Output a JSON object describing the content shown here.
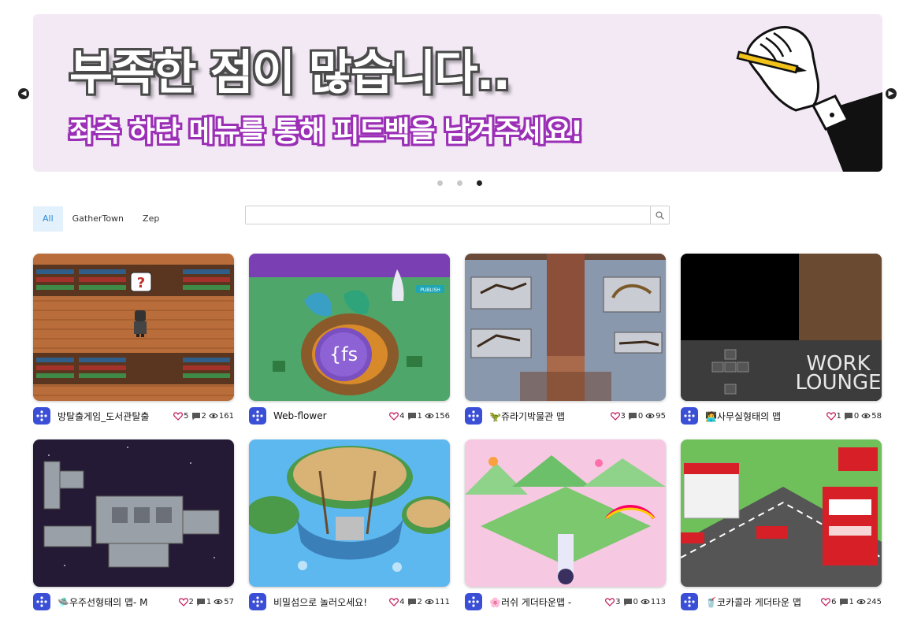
{
  "banner": {
    "title": "부족한 점이 많습니다..",
    "subtitle": "좌측 하단 메뉴를 통해 피드백을 남겨주세요!",
    "accent": "#9b2fb6",
    "background": "#f3e9f5",
    "dots": 3,
    "active_dot": 3
  },
  "filters": {
    "tabs": [
      {
        "label": "All",
        "active": true
      },
      {
        "label": "GatherTown",
        "active": false
      },
      {
        "label": "Zep",
        "active": false
      }
    ]
  },
  "search": {
    "placeholder": "",
    "value": ""
  },
  "cards": [
    {
      "title": "방탈출게임_도서관탈출",
      "likes": "5",
      "comments": "2",
      "views": "161",
      "thumb": "library"
    },
    {
      "title": "Web-flower",
      "likes": "4",
      "comments": "1",
      "views": "156",
      "thumb": "webflower"
    },
    {
      "title": "🦖쥬라기박물관 맵",
      "likes": "3",
      "comments": "0",
      "views": "95",
      "thumb": "museum"
    },
    {
      "title": "🧑‍💻사무실형태의 맵",
      "likes": "1",
      "comments": "0",
      "views": "58",
      "thumb": "lounge"
    },
    {
      "title": "🛸우주선형태의 맵- M",
      "likes": "2",
      "comments": "1",
      "views": "57",
      "thumb": "spaceship"
    },
    {
      "title": "비밀섬으로 놀러오세요!",
      "likes": "4",
      "comments": "2",
      "views": "111",
      "thumb": "island"
    },
    {
      "title": "🌸러쉬 게더타운맵 -",
      "likes": "3",
      "comments": "0",
      "views": "113",
      "thumb": "lush"
    },
    {
      "title": "🥤코카콜라 게더타운 맵",
      "likes": "6",
      "comments": "1",
      "views": "245",
      "thumb": "cocacola"
    }
  ],
  "icons": {
    "prev": "chevron-left-icon",
    "next": "chevron-right-icon",
    "search": "search-icon",
    "like": "heart-icon",
    "comment": "comment-icon",
    "view": "eye-icon",
    "logo": "metaverse-logo-icon"
  },
  "thumb_texts": {
    "publish": "PUBLISH",
    "fs": "{fs",
    "work": "WORK",
    "lounge": "LOUNGE"
  }
}
